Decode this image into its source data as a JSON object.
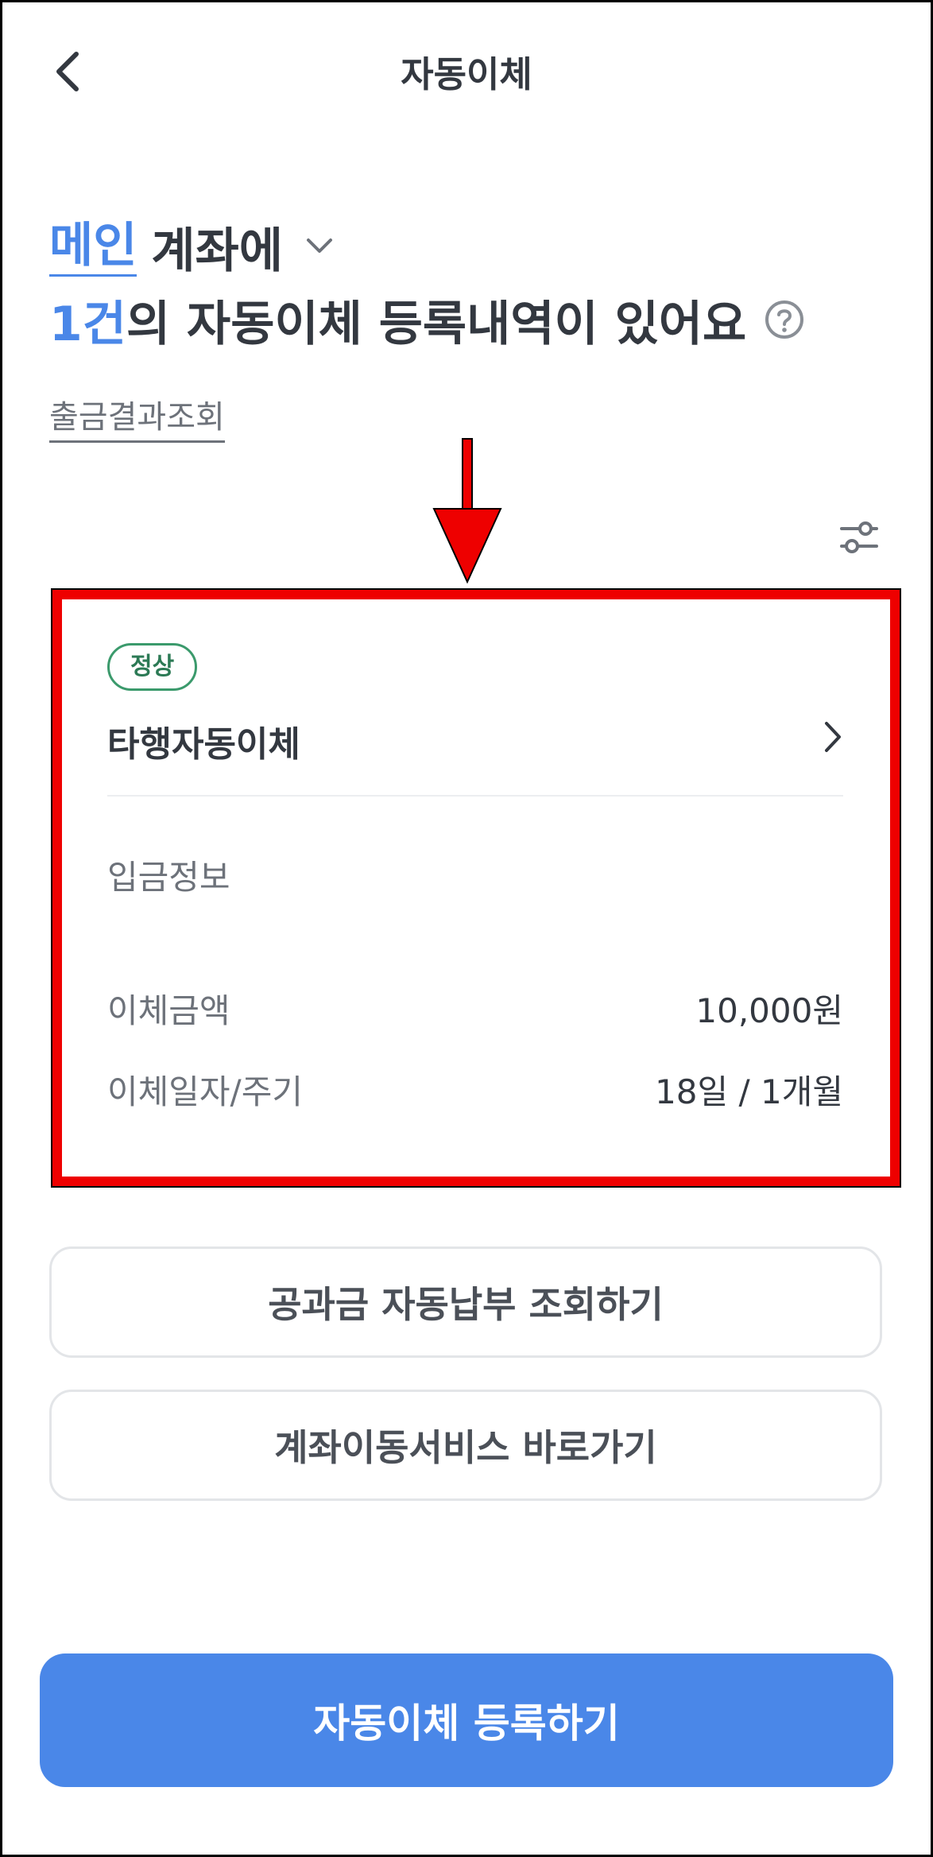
{
  "header": {
    "title": "자동이체"
  },
  "summary": {
    "account_name": "메인",
    "account_suffix": "계좌에",
    "count": "1건",
    "count_suffix": "의 자동이체 등록내역이 있어요"
  },
  "history_link": "출금결과조회",
  "card": {
    "status": "정상",
    "title": "타행자동이체",
    "section_label": "입금정보",
    "rows": [
      {
        "label": "이체금액",
        "value": "10,000원"
      },
      {
        "label": "이체일자/주기",
        "value": "18일 / 1개월"
      }
    ]
  },
  "buttons": {
    "utility": "공과금 자동납부 조회하기",
    "account_move": "계좌이동서비스 바로가기",
    "register": "자동이체 등록하기"
  },
  "colors": {
    "accent": "#4a87e8",
    "status_green": "#3b9a6c",
    "highlight_red": "#ee0000"
  },
  "icons": {
    "back": "back-arrow-icon",
    "dropdown": "chevron-down-icon",
    "help": "question-circle-icon",
    "filter": "filter-sliders-icon",
    "detail": "chevron-right-icon",
    "annotation": "red-arrow-icon"
  }
}
